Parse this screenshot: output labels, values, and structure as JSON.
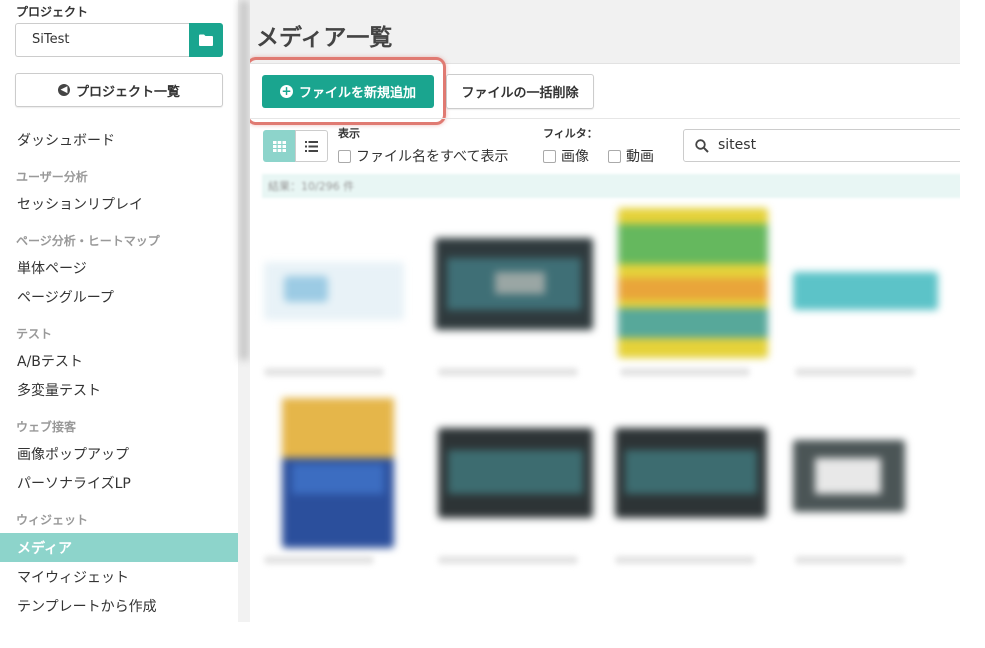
{
  "sidebar": {
    "project_label": "プロジェクト",
    "project_value": "SiTest",
    "project_list_button": "プロジェクト一覧",
    "items": {
      "dashboard": "ダッシュボード",
      "section_user": "ユーザー分析",
      "session_replay": "セッションリプレイ",
      "section_page": "ページ分析・ヒートマップ",
      "single_page": "単体ページ",
      "page_group": "ページグループ",
      "section_test": "テスト",
      "ab_test": "A/Bテスト",
      "mv_test": "多変量テスト",
      "section_web": "ウェブ接客",
      "image_popup": "画像ポップアップ",
      "personalize_lp": "パーソナライズLP",
      "section_widget": "ウィジェット",
      "media": "メディア",
      "my_widget": "マイウィジェット",
      "from_template": "テンプレートから作成"
    }
  },
  "main": {
    "title": "メディア一覧",
    "add_file_button": "ファイルを新規追加",
    "bulk_delete_button": "ファイルの一括削除",
    "display_label": "表示",
    "show_all_names": "ファイル名をすべて表示",
    "filter_label": "フィルタ：",
    "filter_image": "画像",
    "filter_video": "動画",
    "search_value": "sitest",
    "results_text": "結果：10/296 件"
  },
  "colors": {
    "accent": "#1aa58f",
    "active_nav": "#8dd4cb",
    "highlight": "#e07a72"
  }
}
